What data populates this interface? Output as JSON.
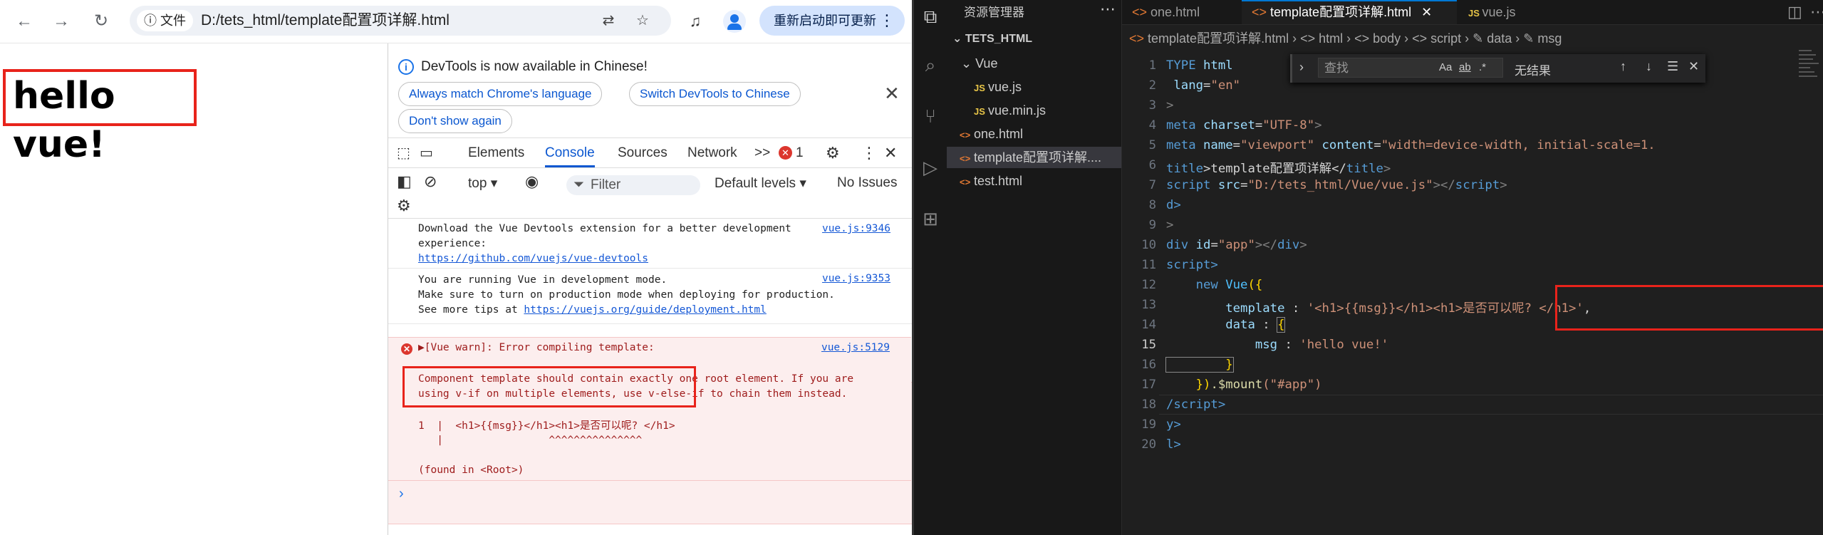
{
  "browser": {
    "nav": {
      "back": "←",
      "forward": "→",
      "reload": "↻"
    },
    "omnibox": {
      "security_label": "文件",
      "url": "D:/tets_html/template配置项详解.html"
    },
    "restart_label": "重新启动即可更新",
    "page": {
      "heading": "hello vue!"
    }
  },
  "devtools": {
    "banner": {
      "message": "DevTools is now available in Chinese!",
      "btn_match": "Always match Chrome's language",
      "btn_switch": "Switch DevTools to Chinese",
      "btn_dont": "Don't show again"
    },
    "tabs": [
      "Elements",
      "Console",
      "Sources",
      "Network"
    ],
    "overflow": ">>",
    "error_count": "1",
    "console_bar": {
      "context": "top",
      "filter_placeholder": "Filter",
      "levels": "Default levels",
      "issues": "No Issues"
    },
    "messages": [
      {
        "line1": "Download the Vue Devtools extension for a better development",
        "line2": "experience:",
        "link": "https://github.com/vuejs/vue-devtools",
        "source": "vue.js:9346"
      },
      {
        "line1": "You are running Vue in development mode.",
        "line2": "Make sure to turn on production mode when deploying for production.",
        "line3_prefix": "See more tips at ",
        "link": "https://vuejs.org/guide/deployment.html",
        "source": "vue.js:9353"
      }
    ],
    "error": {
      "title": "▶[Vue warn]: Error compiling template:",
      "source": "vue.js:5129",
      "detail1": "Component template should contain exactly one root element. If you are",
      "detail2": "using v-if on multiple elements, use v-else-if to chain them instead.",
      "code_line": "1  |  <h1>{{msg}}</h1><h1>是否可以呢? </h1>",
      "code_marker": "   |                 ^^^^^^^^^^^^^^^",
      "found": "(found in <Root>)"
    }
  },
  "vscode": {
    "explorer_title": "资源管理器",
    "root": "TETS_HTML",
    "tree": [
      {
        "label": "Vue",
        "kind": "folder"
      },
      {
        "label": "vue.js",
        "kind": "js"
      },
      {
        "label": "vue.min.js",
        "kind": "js"
      },
      {
        "label": "one.html",
        "kind": "html"
      },
      {
        "label": "template配置项详解....",
        "kind": "html"
      },
      {
        "label": "test.html",
        "kind": "html"
      }
    ],
    "tabs": [
      "one.html",
      "template配置项详解.html",
      "vue.js"
    ],
    "breadcrumb": "template配置项详解.html › <> html › <> body › <> script › ✎ data › ✎ msg",
    "find": {
      "placeholder": "查找",
      "result": "无结果",
      "opt_case": "Aa",
      "opt_word": "ab",
      "opt_regex": ".*"
    },
    "line_numbers": [
      "1",
      "2",
      "3",
      "4",
      "5",
      "6",
      "7",
      "8",
      "9",
      "10",
      "11",
      "12",
      "13",
      "14",
      "15",
      "16",
      "17",
      "18",
      "19",
      "20"
    ],
    "code": {
      "l1a": "TYPE ",
      "l1b": "html",
      "l2a": " lang",
      "l2b": "=",
      "l2c": "\"en\"",
      "l3": ">",
      "l4a": "meta ",
      "l4b": "charset",
      "l4c": "=",
      "l4d": "\"UTF-8\"",
      "l4e": ">",
      "l5a": "meta ",
      "l5b": "name",
      "l5c": "=",
      "l5d": "\"viewport\"",
      "l5e": " content",
      "l5f": "=",
      "l5g": "\"width=device-width, initial-scale=1.",
      "l6a": "title",
      "l6b": ">template配置项详解</",
      "l6c": "title",
      "l6d": ">",
      "l7a": "script ",
      "l7b": "src",
      "l7c": "=",
      "l7d": "\"D:/tets_html/Vue/vue.js\"",
      "l7e": "></",
      "l7f": "script",
      "l7g": ">",
      "l8": "d>",
      "l9": ">",
      "l10a": "div ",
      "l10b": "id",
      "l10c": "=",
      "l10d": "\"app\"",
      "l10e": "></",
      "l10f": "div",
      "l10g": ">",
      "l11": "script>",
      "l12a": "    new ",
      "l12b": "Vue",
      "l12c": "({",
      "l13a": "        template",
      "l13b": " : ",
      "l13c": "'<h1>{{msg}}</h1><h1>是否可以呢? </h1>'",
      "l13d": ",",
      "l14a": "        data",
      "l14b": " : ",
      "l14c": "{",
      "l15a": "            msg",
      "l15b": " : ",
      "l15c": "'hello vue!'",
      "l16": "        }",
      "l17a": "    })",
      "l17b": ".$mount",
      "l17c": "(\"#app\")",
      "l18": "/script>",
      "l19": "y>",
      "l20": "l>"
    }
  }
}
